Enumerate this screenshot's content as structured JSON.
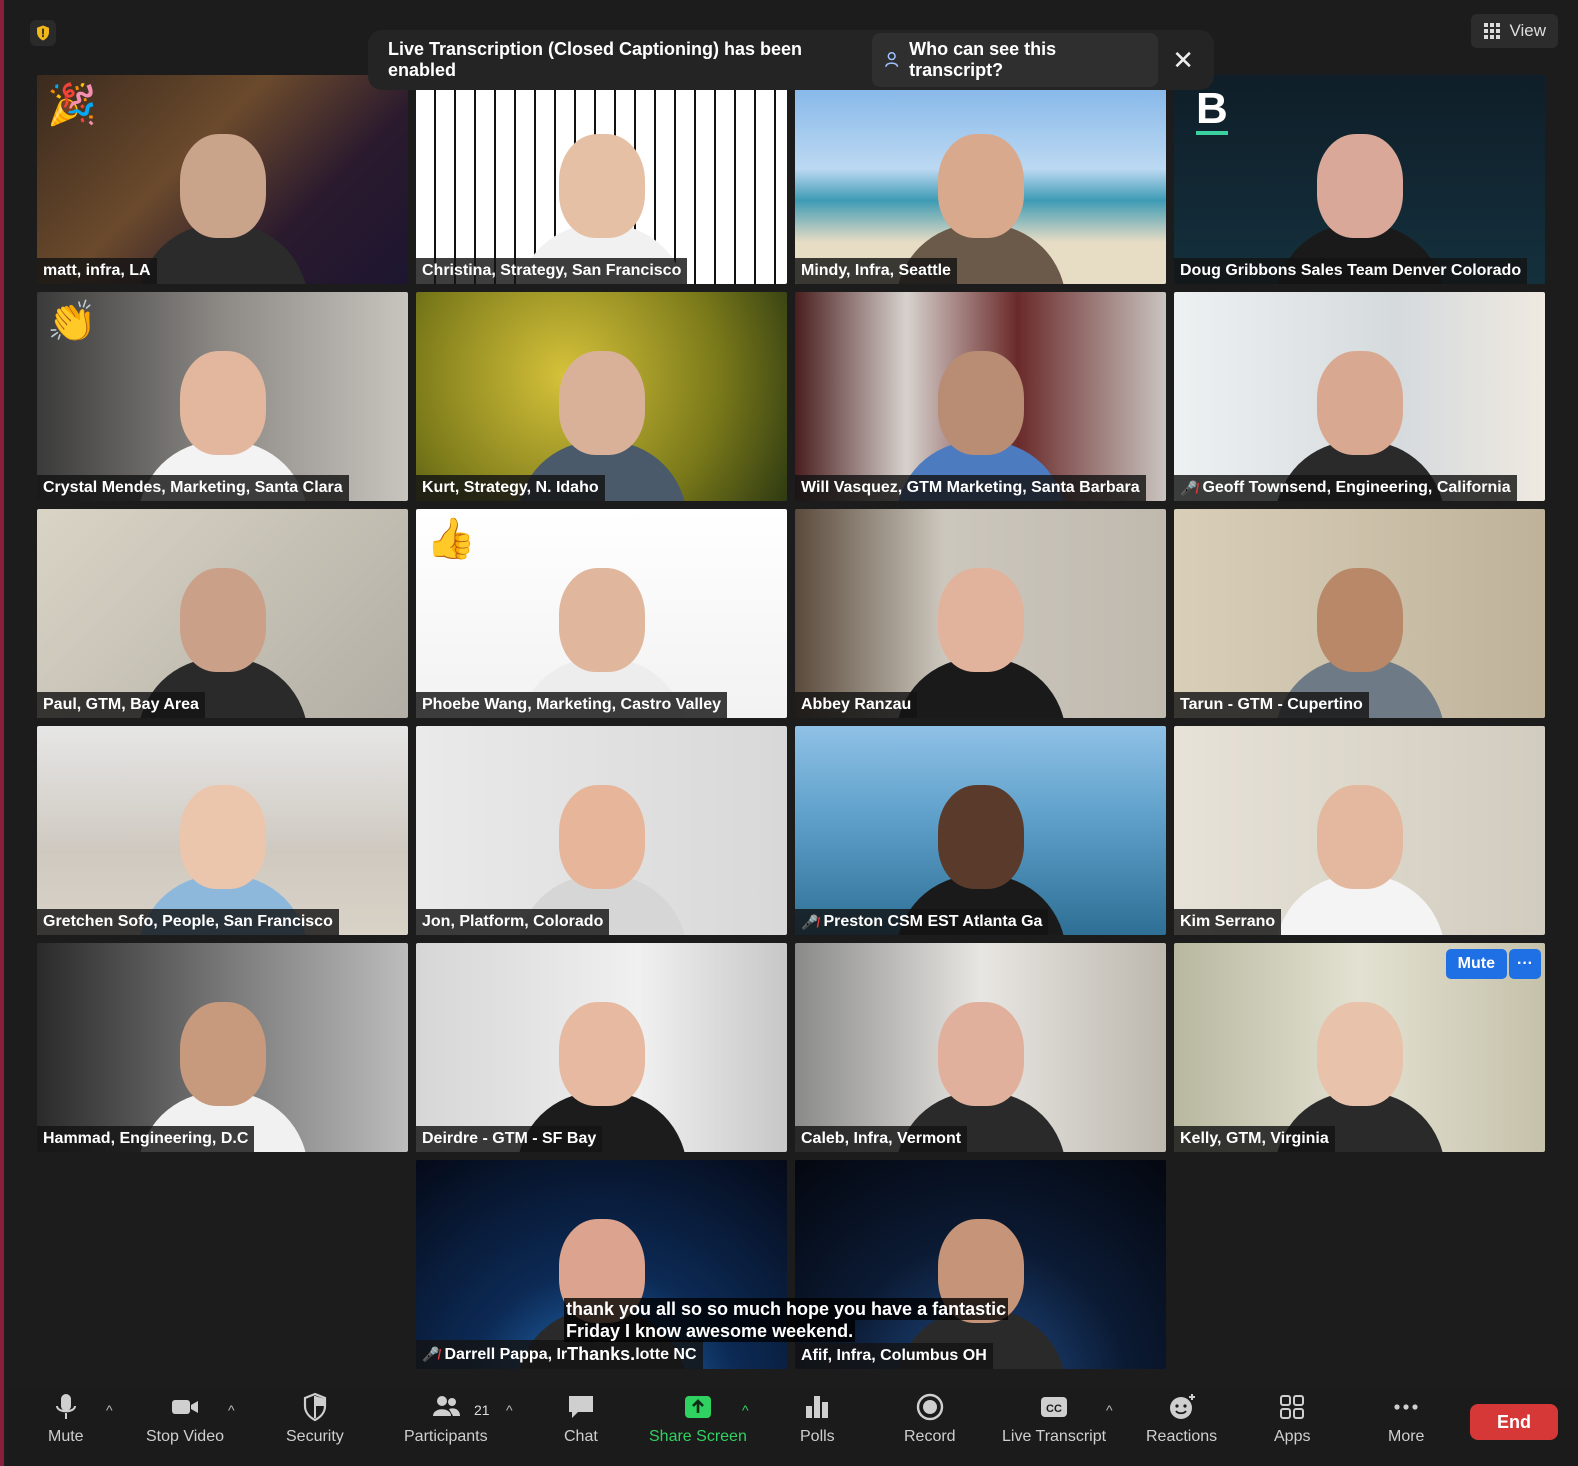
{
  "header": {
    "view_label": "View"
  },
  "banner": {
    "message": "Live Transcription (Closed Captioning) has been enabled",
    "who_label": "Who can see this transcript?"
  },
  "tiles": [
    {
      "name": "matt, infra, LA",
      "muted": false,
      "emoji": "🎉"
    },
    {
      "name": "Christina, Strategy, San Francisco",
      "muted": false,
      "emoji": ""
    },
    {
      "name": "Mindy, Infra, Seattle",
      "muted": false,
      "emoji": "",
      "active": true
    },
    {
      "name": "Doug Gribbons Sales Team Denver Colorado",
      "muted": false,
      "emoji": "",
      "logo": "B"
    },
    {
      "name": "Crystal Mendes, Marketing, Santa Clara",
      "muted": false,
      "emoji": "👏"
    },
    {
      "name": "Kurt, Strategy, N. Idaho",
      "muted": false,
      "emoji": ""
    },
    {
      "name": "Will Vasquez, GTM Marketing, Santa Barbara",
      "muted": false,
      "emoji": ""
    },
    {
      "name": "Geoff Townsend, Engineering, California",
      "muted": true,
      "emoji": ""
    },
    {
      "name": "Paul, GTM, Bay Area",
      "muted": false,
      "emoji": ""
    },
    {
      "name": "Phoebe Wang, Marketing, Castro Valley",
      "muted": false,
      "emoji": "👍"
    },
    {
      "name": "Abbey Ranzau",
      "muted": false,
      "emoji": ""
    },
    {
      "name": "Tarun - GTM - Cupertino",
      "muted": false,
      "emoji": ""
    },
    {
      "name": "Gretchen Sofo, People, San Francisco",
      "muted": false,
      "emoji": ""
    },
    {
      "name": "Jon, Platform, Colorado",
      "muted": false,
      "emoji": ""
    },
    {
      "name": "Preston CSM EST Atlanta Ga",
      "muted": true,
      "emoji": ""
    },
    {
      "name": "Kim Serrano",
      "muted": false,
      "emoji": ""
    },
    {
      "name": "Hammad, Engineering, D.C",
      "muted": false,
      "emoji": ""
    },
    {
      "name": "Deirdre - GTM - SF Bay",
      "muted": false,
      "emoji": ""
    },
    {
      "name": "Caleb, Infra, Vermont",
      "muted": false,
      "emoji": ""
    },
    {
      "name": "Kelly, GTM, Virginia",
      "muted": false,
      "emoji": "",
      "hover_mute": "Mute",
      "hover_more": "···"
    },
    {
      "name": "Darrell Pappa, Ir",
      "muted": true,
      "emoji": ""
    },
    {
      "name": "Afif, Infra, Columbus OH",
      "muted": false,
      "emoji": ""
    }
  ],
  "caption": {
    "line1": "thank you all so so much hope you have a fantastic",
    "line2": "Friday I know awesome weekend.",
    "line3": "Thanks.",
    "darrell_suffix": "lotte NC"
  },
  "toolbar": {
    "mute": "Mute",
    "stop_video": "Stop Video",
    "security": "Security",
    "participants": "Participants",
    "participant_count": "21",
    "chat": "Chat",
    "share_screen": "Share Screen",
    "polls": "Polls",
    "record": "Record",
    "live_transcript": "Live Transcript",
    "reactions": "Reactions",
    "apps": "Apps",
    "more": "More",
    "end": "End"
  },
  "colors": {
    "accent_green": "#2fd160",
    "end_red": "#d63737",
    "mute_blue": "#1f6fe5",
    "active_speaker": "#b5c96a"
  }
}
